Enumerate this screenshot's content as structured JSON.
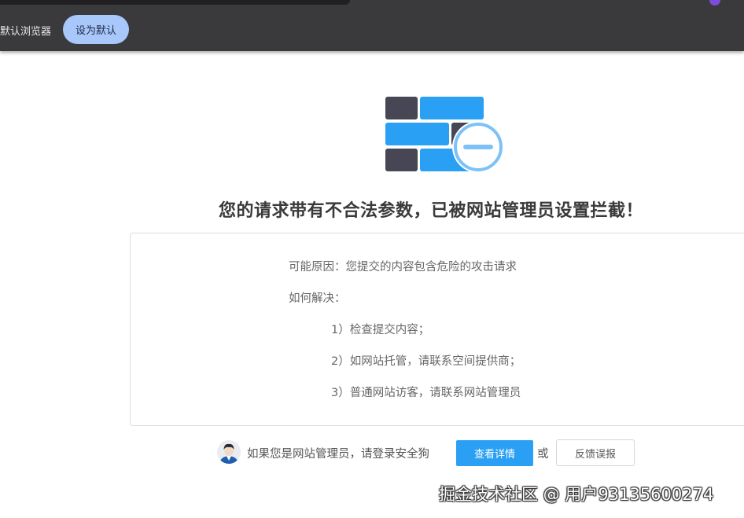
{
  "browser_bar": {
    "default_browser_text": "默认浏览器",
    "set_default_button": "设为默认"
  },
  "main": {
    "headline": "您的请求带有不合法参数，已被网站管理员设置拦截！",
    "reason": "可能原因：您提交的内容包含危险的攻击请求",
    "how_to_solve": "如何解决：",
    "steps": [
      "1）检查提交内容；",
      "2）如网站托管，请联系空间提供商；",
      "3）普通网站访客，请联系网站管理员"
    ]
  },
  "footer": {
    "admin_prompt": "如果您是网站管理员，请登录安全狗",
    "detail_button": "查看详情",
    "or_text": "或",
    "feedback_button": "反馈误报"
  },
  "watermark": "掘金技术社区 @ 用户93135600274",
  "colors": {
    "brick_dark": "#474654",
    "brick_blue": "#2aa0f4",
    "badge_ring": "#7cc2f7",
    "primary_button": "#2aa0f4",
    "topbar": "#3a3a3c",
    "pill_button": "#a8c7fa"
  }
}
